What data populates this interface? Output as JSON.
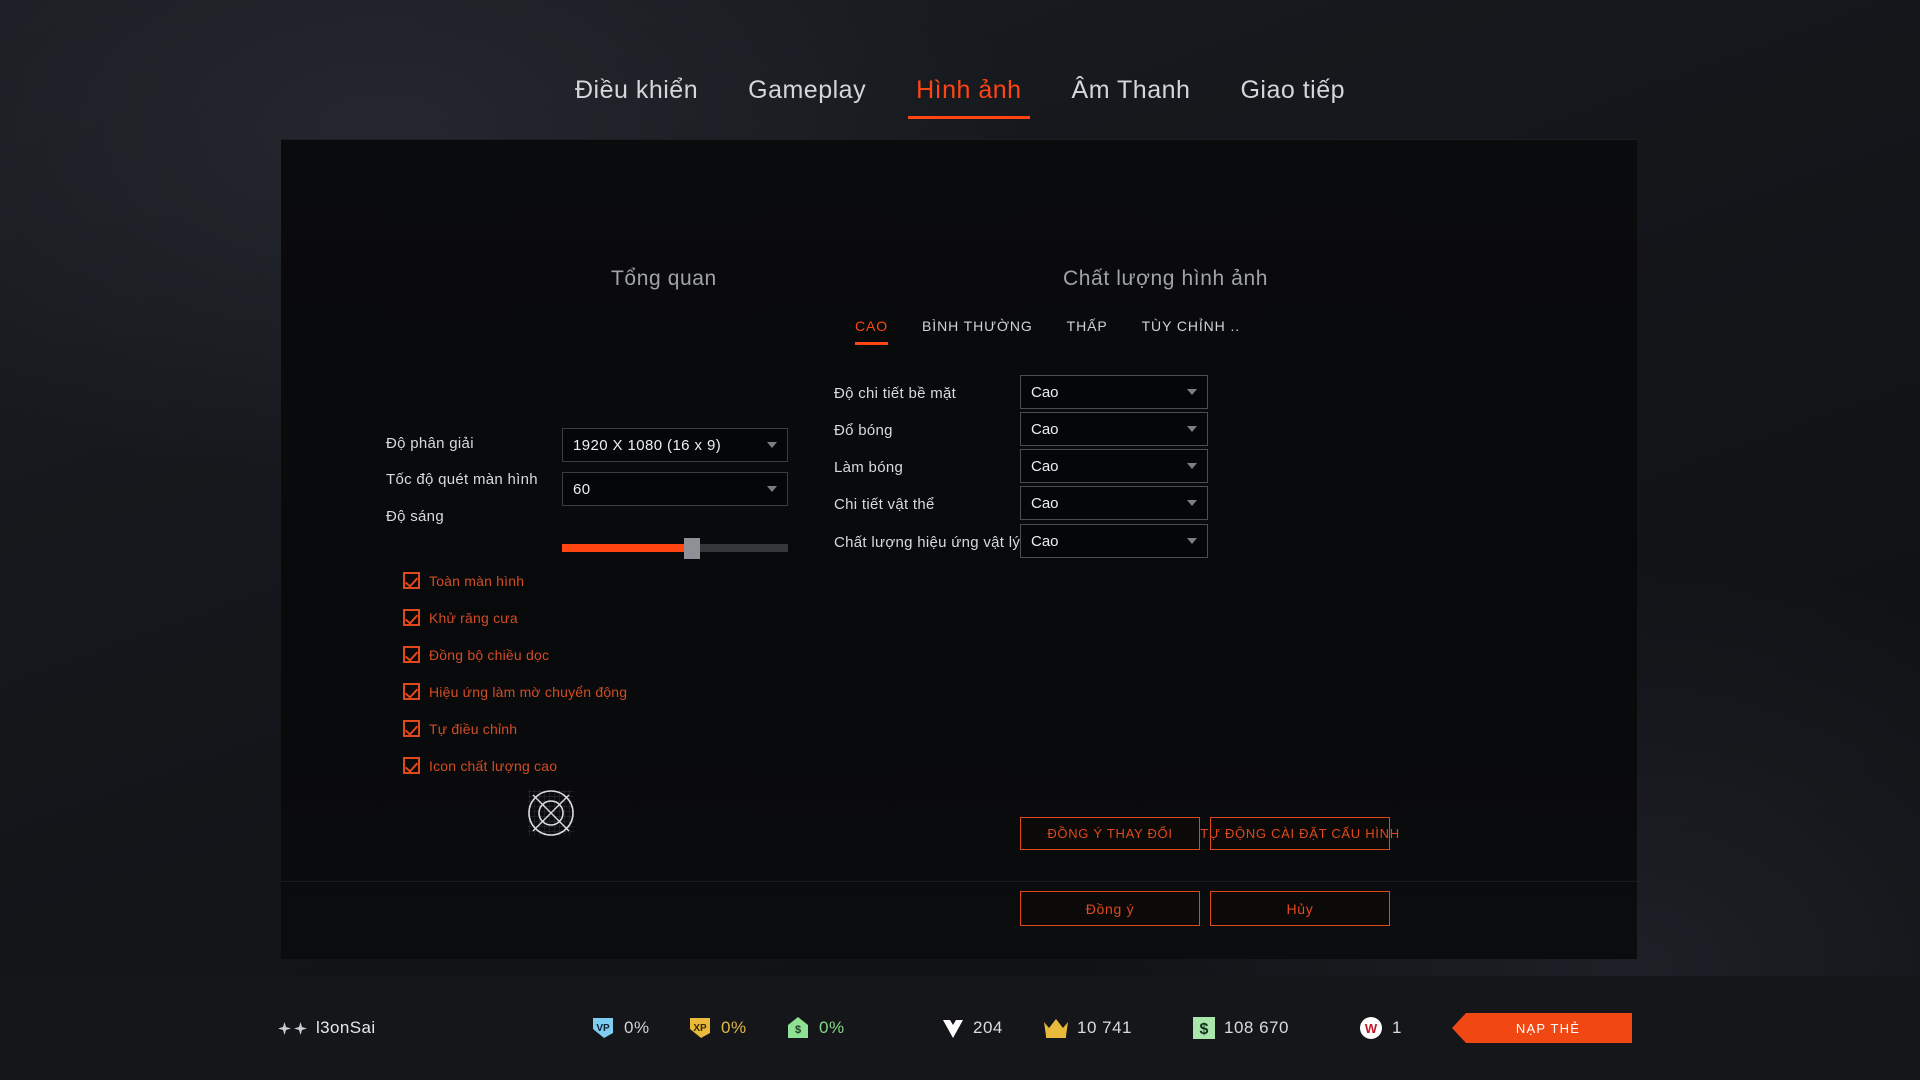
{
  "nav": {
    "tabs": [
      {
        "label": "Điều khiển",
        "active": false
      },
      {
        "label": "Gameplay",
        "active": false
      },
      {
        "label": "Hình ảnh",
        "active": true
      },
      {
        "label": "Âm Thanh",
        "active": false
      },
      {
        "label": "Giao tiếp",
        "active": false
      }
    ]
  },
  "overview": {
    "title": "Tổng quan",
    "resolution": {
      "label": "Độ phân giải",
      "value": "1920 X 1080 (16 x 9)"
    },
    "refresh_rate": {
      "label": "Tốc độ quét màn hình",
      "value": "60"
    },
    "brightness": {
      "label": "Độ sáng",
      "value_percent": 57
    },
    "checkboxes": [
      {
        "label": "Toàn màn hình",
        "checked": true
      },
      {
        "label": "Khử răng cưa",
        "checked": true
      },
      {
        "label": "Đồng bộ chiều dọc",
        "checked": true
      },
      {
        "label": "Hiệu ứng làm mờ chuyển động",
        "checked": true
      },
      {
        "label": "Tự điều chỉnh",
        "checked": true
      },
      {
        "label": "Icon chất lượng cao",
        "checked": true
      }
    ],
    "crosshair_preview": "crosshair-reticle-icon"
  },
  "quality": {
    "title": "Chất lượng hình ảnh",
    "presets": [
      {
        "label": "CAO",
        "active": true
      },
      {
        "label": "BÌNH THƯỜNG",
        "active": false
      },
      {
        "label": "THẤP",
        "active": false
      },
      {
        "label": "TÙY CHỈNH ..",
        "active": false
      }
    ],
    "rows": [
      {
        "label": "Độ chi tiết bề mặt",
        "value": "Cao"
      },
      {
        "label": "Đổ bóng",
        "value": "Cao"
      },
      {
        "label": "Làm bóng",
        "value": "Cao"
      },
      {
        "label": "Chi tiết vật thể",
        "value": "Cao"
      },
      {
        "label": "Chất lượng hiệu ứng vật lý",
        "value": "Cao"
      }
    ]
  },
  "actions": {
    "apply_changes": "ĐỒNG Ý THAY ĐỔI",
    "auto_config": "TỰ ĐỘNG CÀI ĐẶT CẤU HÌNH",
    "confirm": "Đồng ý",
    "cancel": "Hủy"
  },
  "statusbar": {
    "player_name": "l3onSai",
    "stats": [
      {
        "icon": "vp-badge-icon",
        "value": "0%"
      },
      {
        "icon": "xp-badge-icon",
        "value": "0%"
      },
      {
        "icon": "money-badge-icon",
        "value": "0%"
      },
      {
        "icon": "gem-icon",
        "value": "204"
      },
      {
        "icon": "crown-icon",
        "value": "10 741"
      },
      {
        "icon": "dollar-icon",
        "value": "108 670"
      },
      {
        "icon": "w-circle-icon",
        "value": "1"
      }
    ],
    "topup_label": "NẠP THẺ"
  },
  "colors": {
    "accent": "#ff4612",
    "checkbox": "#e0491c",
    "panel_bg": "#0a0b0d"
  }
}
